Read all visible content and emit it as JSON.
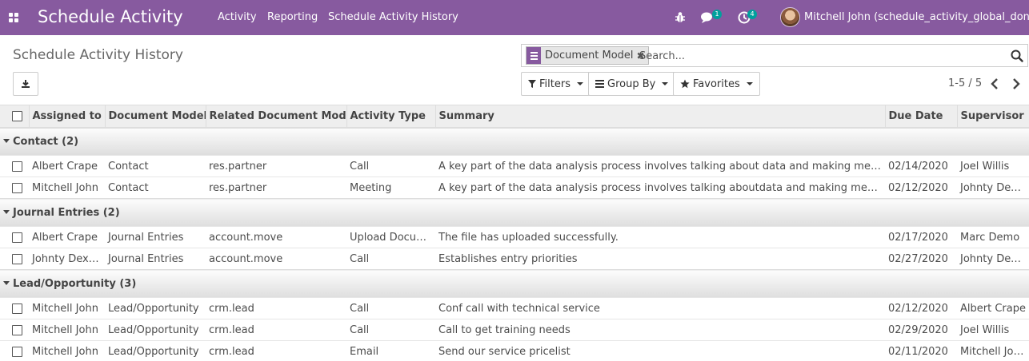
{
  "navbar": {
    "brand": "Schedule Activity",
    "menu": [
      "Activity",
      "Reporting",
      "Schedule Activity History"
    ],
    "messages_count": "1",
    "activities_count": "4",
    "user_name": "Mitchell John (schedule_activity_global_done)"
  },
  "control_panel": {
    "title": "Schedule Activity History",
    "facet_value": "Document Model",
    "search_placeholder": "Search...",
    "filters_label": "Filters",
    "group_by_label": "Group By",
    "favorites_label": "Favorites",
    "pager_value": "1-5 / 5"
  },
  "table": {
    "headers": {
      "assigned_to": "Assigned to",
      "document_model": "Document Model",
      "related_model": "Related Document Model",
      "activity_type": "Activity Type",
      "summary": "Summary",
      "due_date": "Due Date",
      "supervisor": "Supervisor"
    },
    "groups": [
      {
        "label": "Contact (2)",
        "rows": [
          {
            "assigned_to": "Albert Crape",
            "document_model": "Contact",
            "related_model": "res.partner",
            "activity_type": "Call",
            "summary": "A key part of the data analysis process involves talking about data and making meaning of data",
            "due_date": "02/14/2020",
            "supervisor": "Joel Willis"
          },
          {
            "assigned_to": "Mitchell John",
            "document_model": "Contact",
            "related_model": "res.partner",
            "activity_type": "Meeting",
            "summary": "A key part of the data analysis process involves talking aboutdata and making meaning of data",
            "due_date": "02/12/2020",
            "supervisor": "Johnty Dexter"
          }
        ]
      },
      {
        "label": "Journal Entries (2)",
        "rows": [
          {
            "assigned_to": "Albert Crape",
            "document_model": "Journal Entries",
            "related_model": "account.move",
            "activity_type": "Upload Document",
            "summary": "The file has uploaded successfully.",
            "due_date": "02/17/2020",
            "supervisor": "Marc Demo"
          },
          {
            "assigned_to": "Johnty Dexter",
            "document_model": "Journal Entries",
            "related_model": "account.move",
            "activity_type": "Call",
            "summary": "Establishes entry priorities",
            "due_date": "02/27/2020",
            "supervisor": "Johnty Dexter"
          }
        ]
      },
      {
        "label": "Lead/Opportunity (3)",
        "rows": [
          {
            "assigned_to": "Mitchell John",
            "document_model": "Lead/Opportunity",
            "related_model": "crm.lead",
            "activity_type": "Call",
            "summary": "Conf call with technical service",
            "due_date": "02/12/2020",
            "supervisor": "Albert Crape"
          },
          {
            "assigned_to": "Mitchell John",
            "document_model": "Lead/Opportunity",
            "related_model": "crm.lead",
            "activity_type": "Call",
            "summary": "Call to get training needs",
            "due_date": "02/29/2020",
            "supervisor": "Joel Willis"
          },
          {
            "assigned_to": "Mitchell John",
            "document_model": "Lead/Opportunity",
            "related_model": "crm.lead",
            "activity_type": "Email",
            "summary": "Send our service pricelist",
            "due_date": "02/11/2020",
            "supervisor": "Mitchell John"
          }
        ]
      }
    ]
  }
}
